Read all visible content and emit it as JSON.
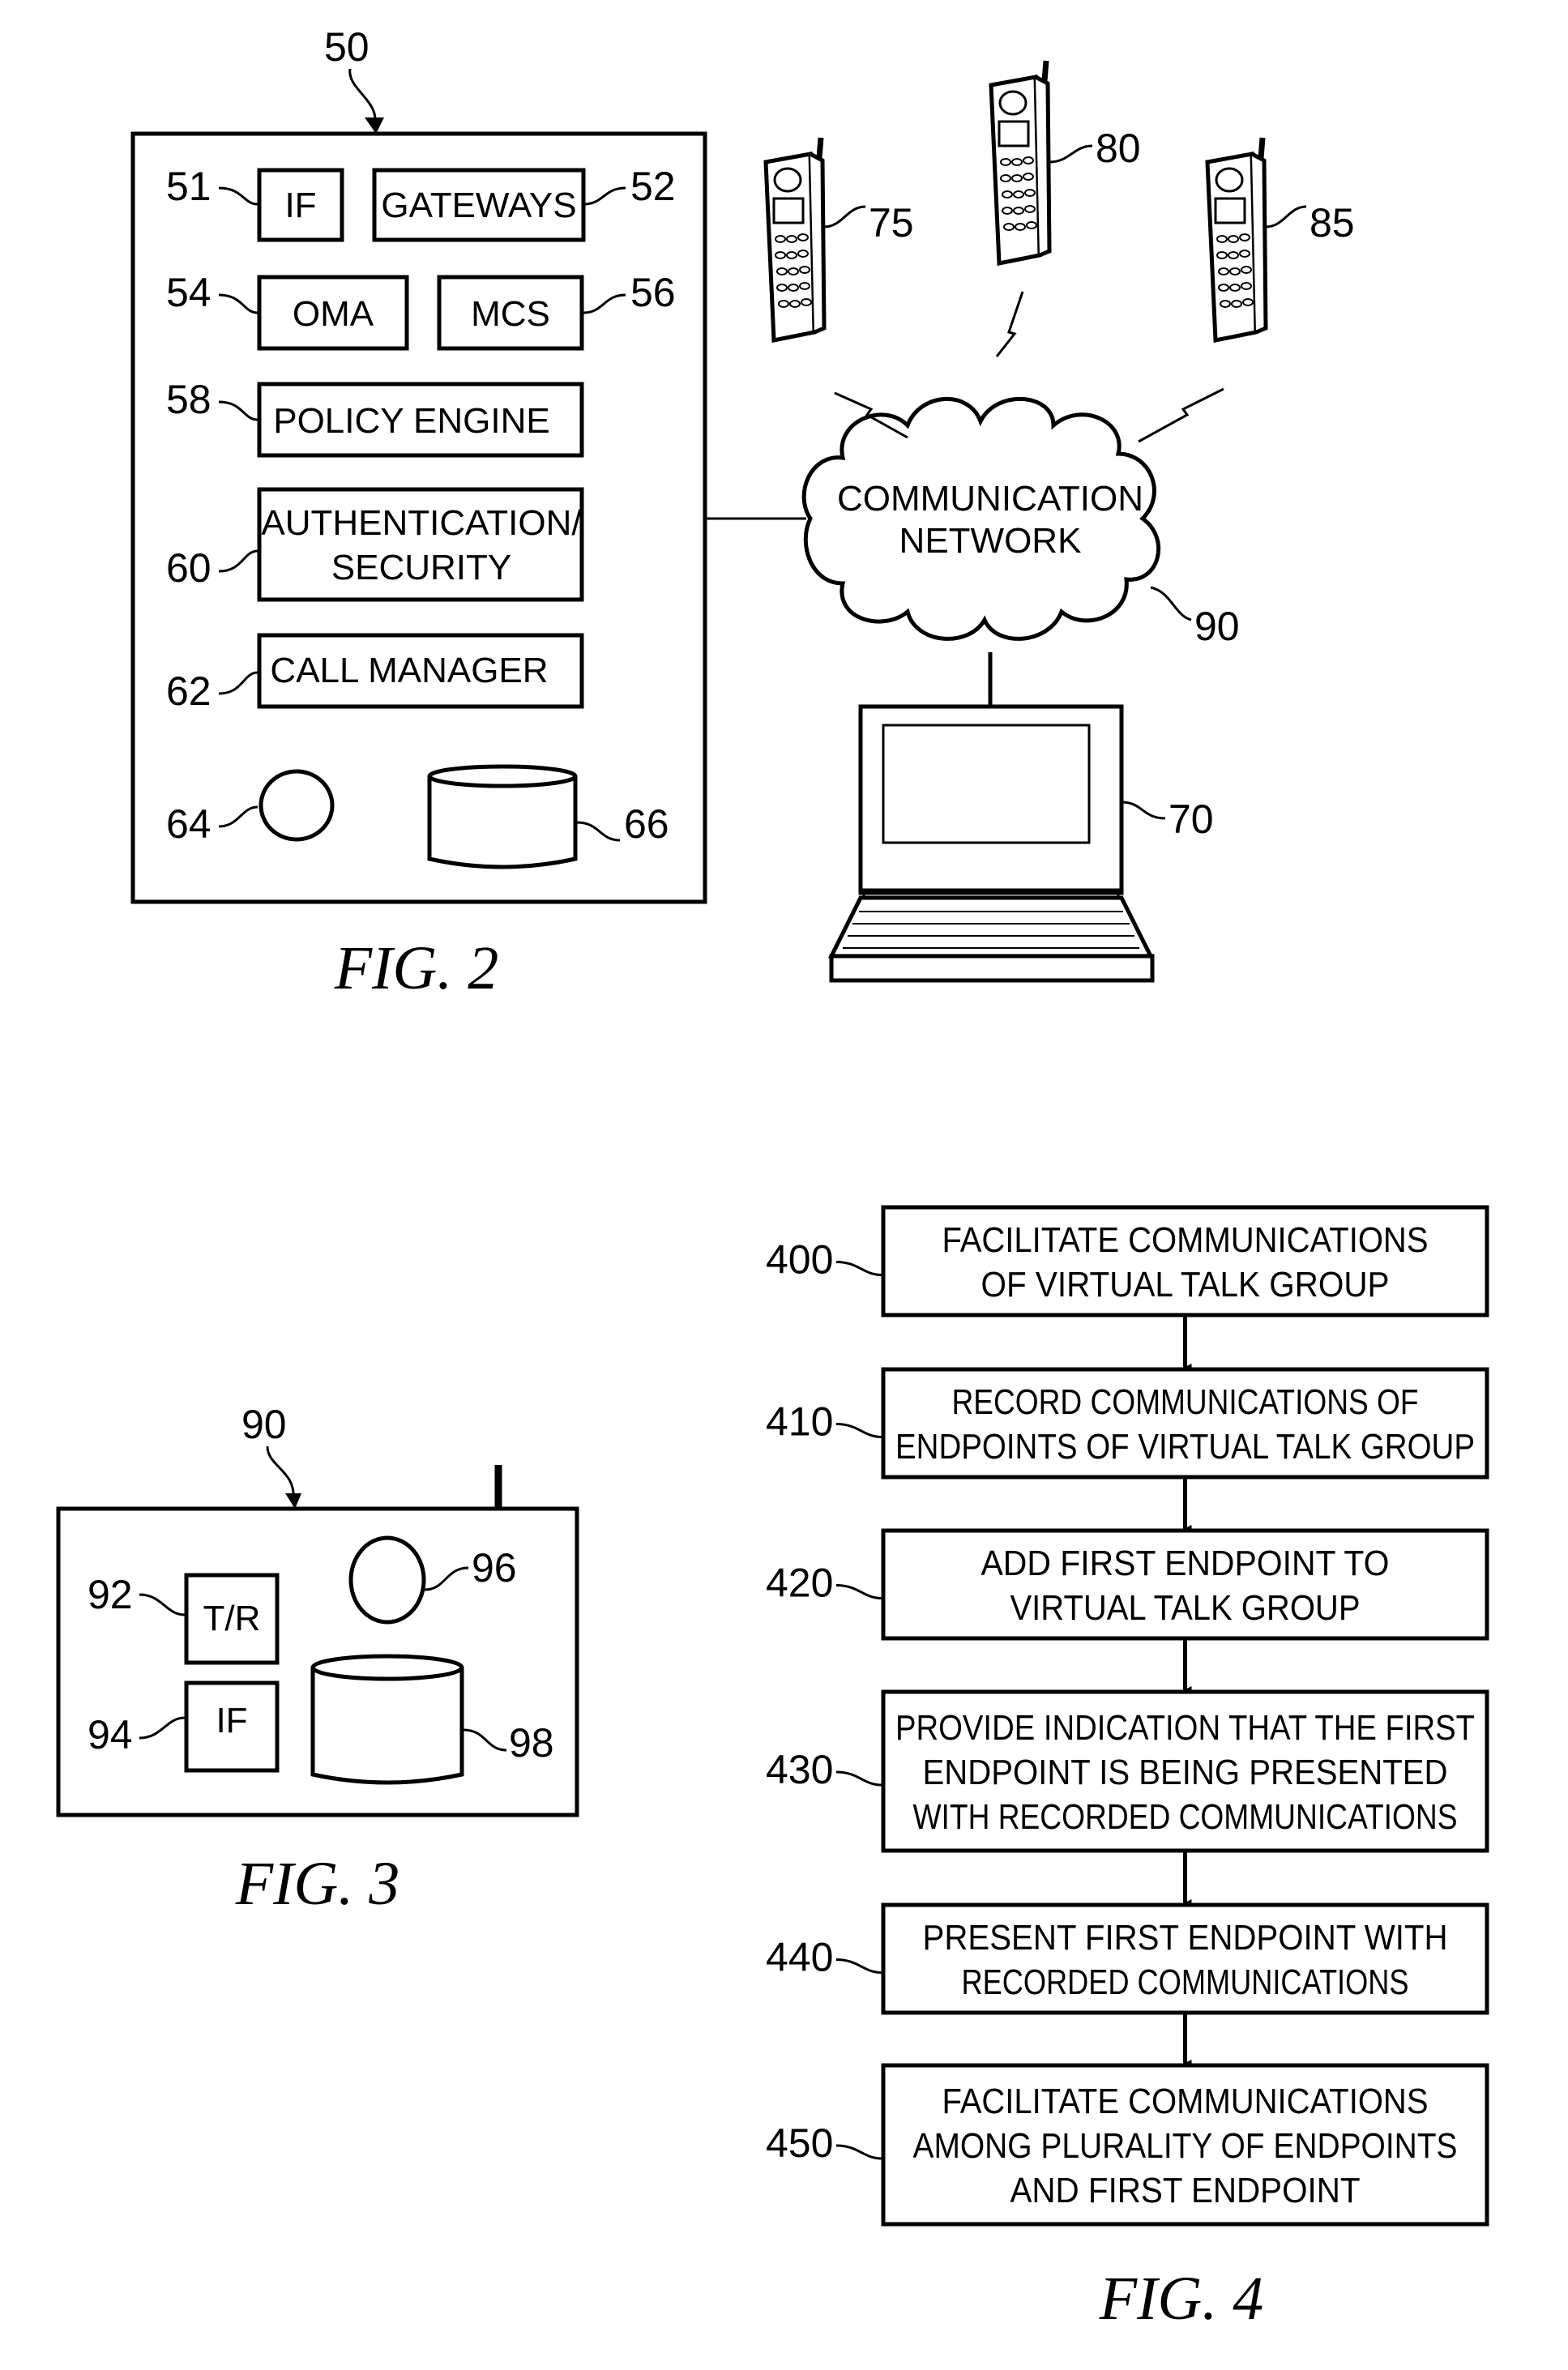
{
  "fig2": {
    "caption": "FIG. 2",
    "system_ref": "50",
    "components": [
      {
        "ref": "51",
        "label": "IF"
      },
      {
        "ref": "52",
        "label": "GATEWAYS"
      },
      {
        "ref": "54",
        "label": "OMA"
      },
      {
        "ref": "56",
        "label": "MCS"
      },
      {
        "ref": "58",
        "label": "POLICY ENGINE"
      },
      {
        "ref": "60",
        "label_line1": "AUTHENTICATION/",
        "label_line2": "SECURITY"
      },
      {
        "ref": "62",
        "label": "CALL MANAGER"
      },
      {
        "ref": "64",
        "label": ""
      },
      {
        "ref": "66",
        "label": ""
      }
    ],
    "network": {
      "ref": "90",
      "line1": "COMMUNICATION",
      "line2": "NETWORK"
    },
    "endpoints": [
      {
        "ref": "75",
        "type": "mobile-phone"
      },
      {
        "ref": "80",
        "type": "mobile-phone"
      },
      {
        "ref": "85",
        "type": "mobile-phone"
      },
      {
        "ref": "70",
        "type": "laptop"
      }
    ]
  },
  "fig3": {
    "caption": "FIG. 3",
    "device_ref": "90",
    "components": [
      {
        "ref": "92",
        "label": "T/R"
      },
      {
        "ref": "94",
        "label": "IF"
      },
      {
        "ref": "96",
        "label": ""
      },
      {
        "ref": "98",
        "label": ""
      }
    ]
  },
  "fig4": {
    "caption": "FIG. 4",
    "steps": [
      {
        "ref": "400",
        "lines": [
          "FACILITATE COMMUNICATIONS",
          "OF VIRTUAL TALK GROUP"
        ]
      },
      {
        "ref": "410",
        "lines": [
          "RECORD COMMUNICATIONS OF",
          "ENDPOINTS OF VIRTUAL TALK GROUP"
        ]
      },
      {
        "ref": "420",
        "lines": [
          "ADD FIRST ENDPOINT TO",
          "VIRTUAL TALK GROUP"
        ]
      },
      {
        "ref": "430",
        "lines": [
          "PROVIDE INDICATION THAT THE FIRST",
          "ENDPOINT IS BEING PRESENTED",
          "WITH RECORDED COMMUNICATIONS"
        ]
      },
      {
        "ref": "440",
        "lines": [
          "PRESENT FIRST ENDPOINT WITH",
          "RECORDED COMMUNICATIONS"
        ]
      },
      {
        "ref": "450",
        "lines": [
          "FACILITATE COMMUNICATIONS",
          "AMONG PLURALITY OF ENDPOINTS",
          "AND FIRST ENDPOINT"
        ]
      }
    ]
  }
}
